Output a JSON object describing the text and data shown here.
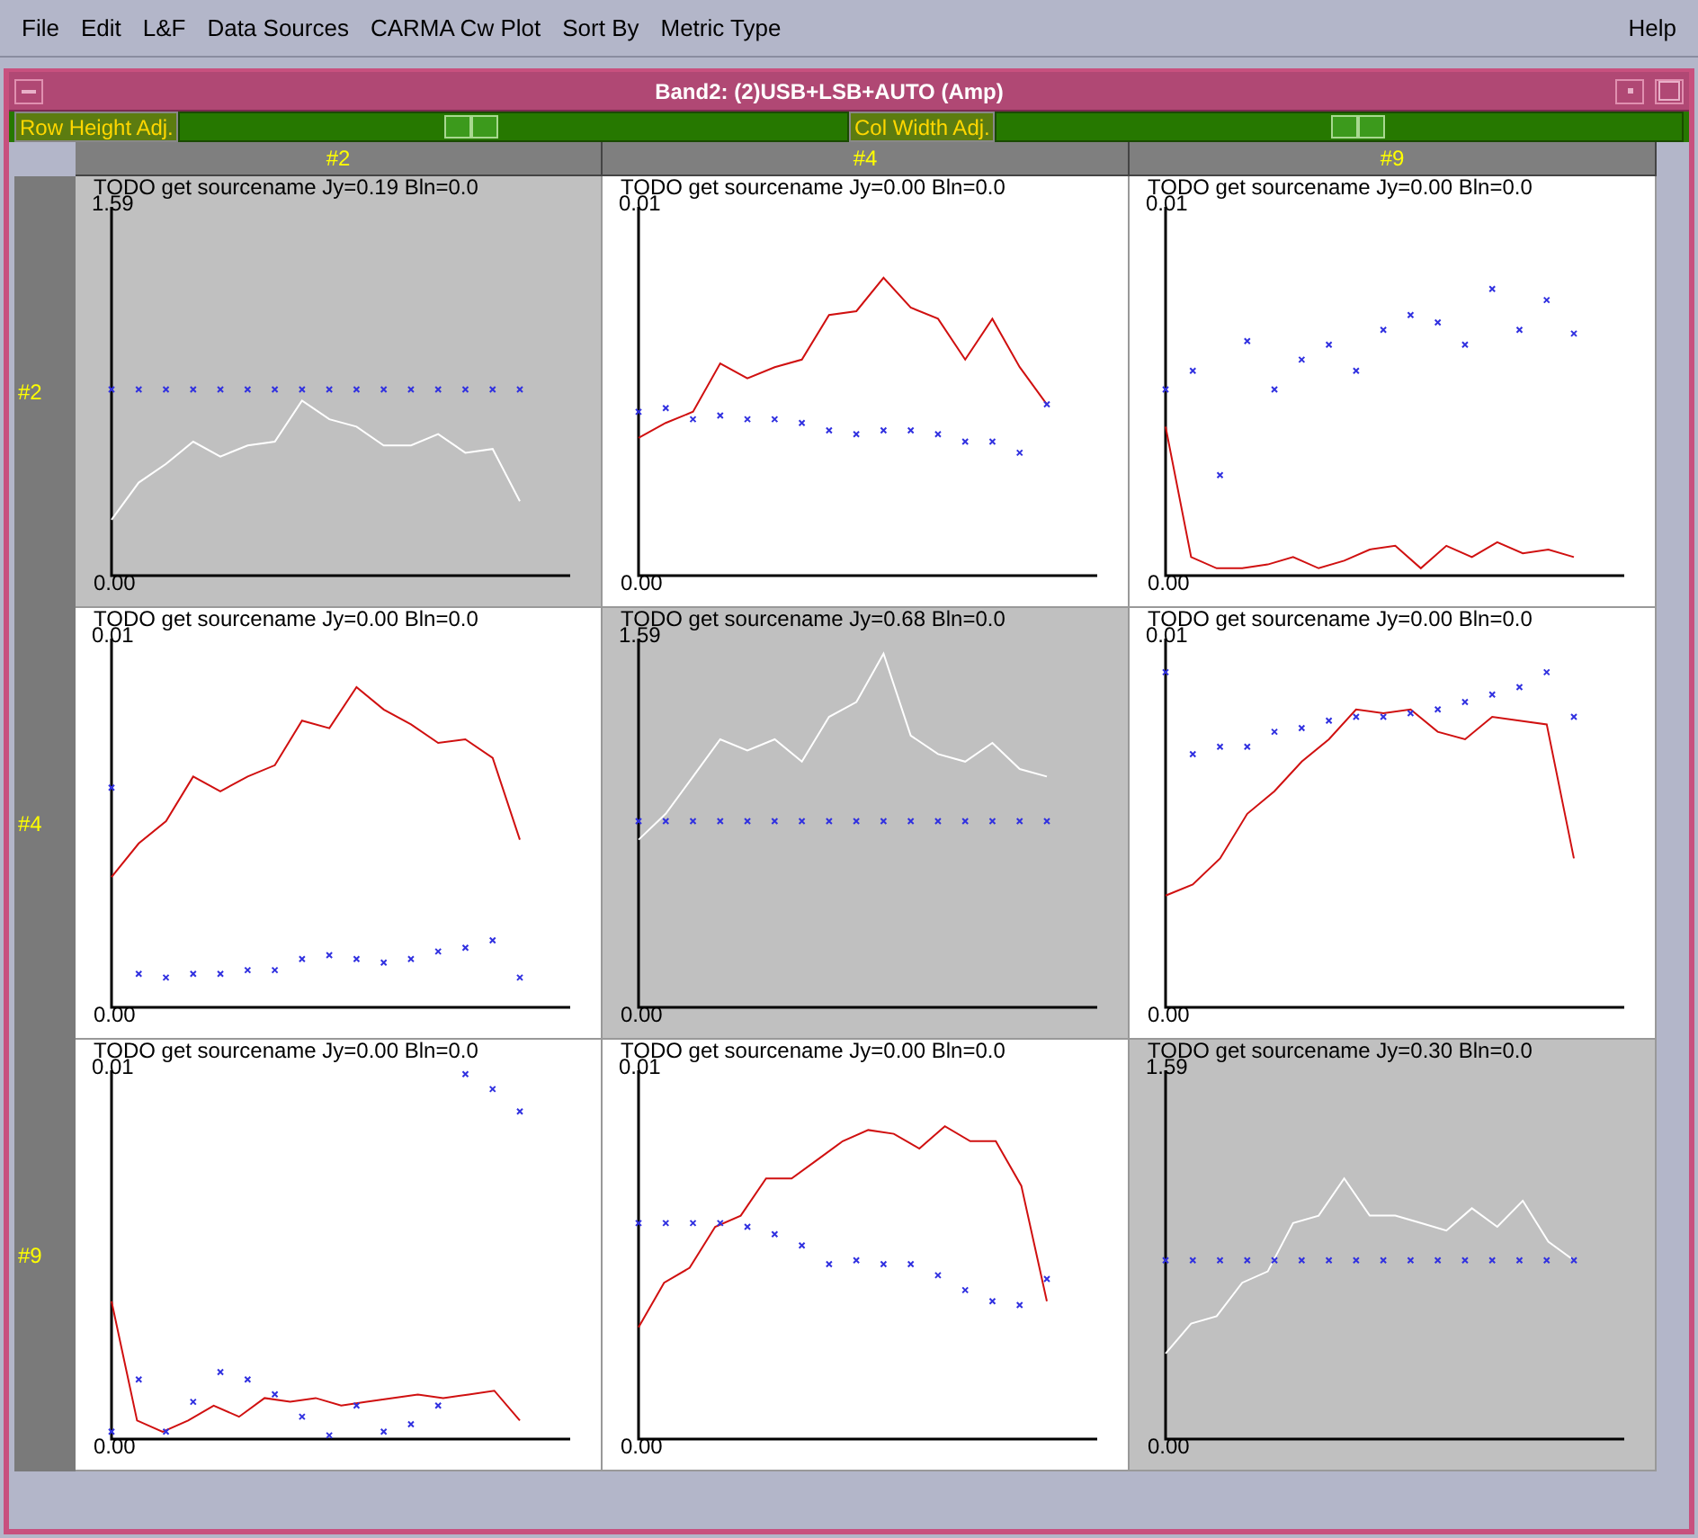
{
  "menu_bar": {
    "items": [
      "File",
      "Edit",
      "L&F",
      "Data Sources",
      "CARMA Cw Plot",
      "Sort By",
      "Metric Type"
    ],
    "help": "Help"
  },
  "window": {
    "title": "Band2: (2)USB+LSB+AUTO (Amp)"
  },
  "sliders": [
    {
      "label": "Row Height Adj.",
      "level": 0.43
    },
    {
      "label": "Col Width Adj.",
      "level": 0.53
    }
  ],
  "column_headers": [
    "#2",
    "#4",
    "#9"
  ],
  "rows": [
    {
      "header": "#2",
      "cells": [
        {
          "kind": "auto",
          "title": "TODO get sourcename Jy=0.19 Bln=0.0",
          "y_max": "1.59",
          "y_min": "0.00"
        },
        {
          "kind": "cross",
          "title": "TODO get sourcename Jy=0.00 Bln=0.0",
          "y_max": "0.01",
          "y_min": "0.00"
        },
        {
          "kind": "cross",
          "title": "TODO get sourcename Jy=0.00 Bln=0.0",
          "y_max": "0.01",
          "y_min": "0.00"
        }
      ]
    },
    {
      "header": "#4",
      "cells": [
        {
          "kind": "cross",
          "title": "TODO get sourcename Jy=0.00 Bln=0.0",
          "y_max": "0.01",
          "y_min": "0.00"
        },
        {
          "kind": "auto",
          "title": "TODO get sourcename Jy=0.68 Bln=0.0",
          "y_max": "1.59",
          "y_min": "0.00"
        },
        {
          "kind": "cross",
          "title": "TODO get sourcename Jy=0.00 Bln=0.0",
          "y_max": "0.01",
          "y_min": "0.00"
        }
      ]
    },
    {
      "header": "#9",
      "cells": [
        {
          "kind": "cross",
          "title": "TODO get sourcename Jy=0.00 Bln=0.0",
          "y_max": "0.01",
          "y_min": "0.00"
        },
        {
          "kind": "cross",
          "title": "TODO get sourcename Jy=0.00 Bln=0.0",
          "y_max": "0.01",
          "y_min": "0.00"
        },
        {
          "kind": "auto",
          "title": "TODO get sourcename Jy=0.30 Bln=0.0",
          "y_max": "1.59",
          "y_min": "0.00"
        }
      ]
    }
  ]
}
